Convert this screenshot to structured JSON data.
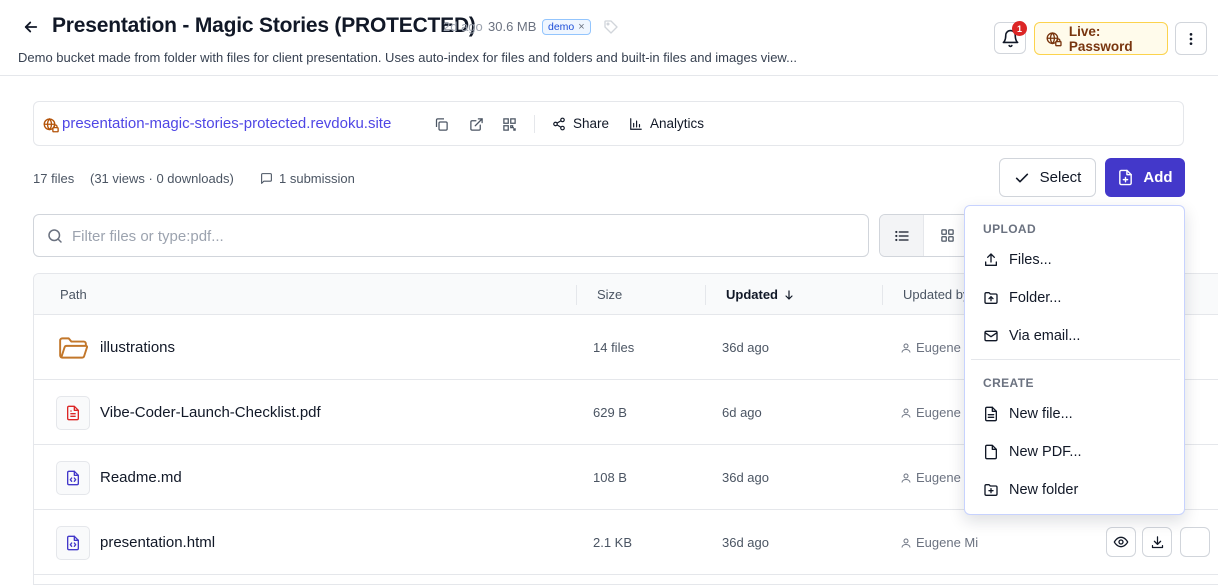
{
  "header": {
    "title": "Presentation - Magic Stories (PROTECTED)",
    "age": "2d ago",
    "size": "30.6 MB",
    "badge": "demo",
    "badge_remove": "×",
    "description": "Demo bucket made from folder with files for client presentation. Uses auto-index for files and folders and built-in files and images view...",
    "notifications_count": "1",
    "live_label": "Live: Password"
  },
  "url_bar": {
    "url": "presentation-magic-stories-protected.revdoku.site",
    "share_label": "Share",
    "analytics_label": "Analytics"
  },
  "stats": {
    "files": "17 files",
    "views": "(31 views · 0 downloads)",
    "submissions": "1 submission"
  },
  "toolbar": {
    "select_label": "Select",
    "add_label": "Add",
    "search_placeholder": "Filter files or type:pdf..."
  },
  "table": {
    "columns": {
      "path": "Path",
      "size": "Size",
      "updated": "Updated",
      "updated_by": "Updated by"
    },
    "rows": [
      {
        "name": "illustrations",
        "size": "14 files",
        "updated": "36d ago",
        "by": "Eugene",
        "icon": "folder-icon"
      },
      {
        "name": "Vibe-Coder-Launch-Checklist.pdf",
        "size": "629 B",
        "updated": "6d ago",
        "by": "Eugene",
        "icon": "pdf-file-icon"
      },
      {
        "name": "Readme.md",
        "size": "108 B",
        "updated": "36d ago",
        "by": "Eugene",
        "icon": "code-file-icon"
      },
      {
        "name": "presentation.html",
        "size": "2.1 KB",
        "updated": "36d ago",
        "by": "Eugene Mi",
        "icon": "code-file-icon"
      }
    ]
  },
  "add_menu": {
    "upload_heading": "UPLOAD",
    "upload_items": [
      "Files...",
      "Folder...",
      "Via email..."
    ],
    "create_heading": "CREATE",
    "create_items": [
      "New file...",
      "New PDF...",
      "New folder"
    ]
  },
  "colors": {
    "accent": "#4338ca",
    "link": "#4f46e5",
    "live_bg": "#fffbeb",
    "live_border": "#fcd34d",
    "notification": "#dc2626",
    "folder": "#c2772b",
    "pdf": "#dc2626"
  }
}
